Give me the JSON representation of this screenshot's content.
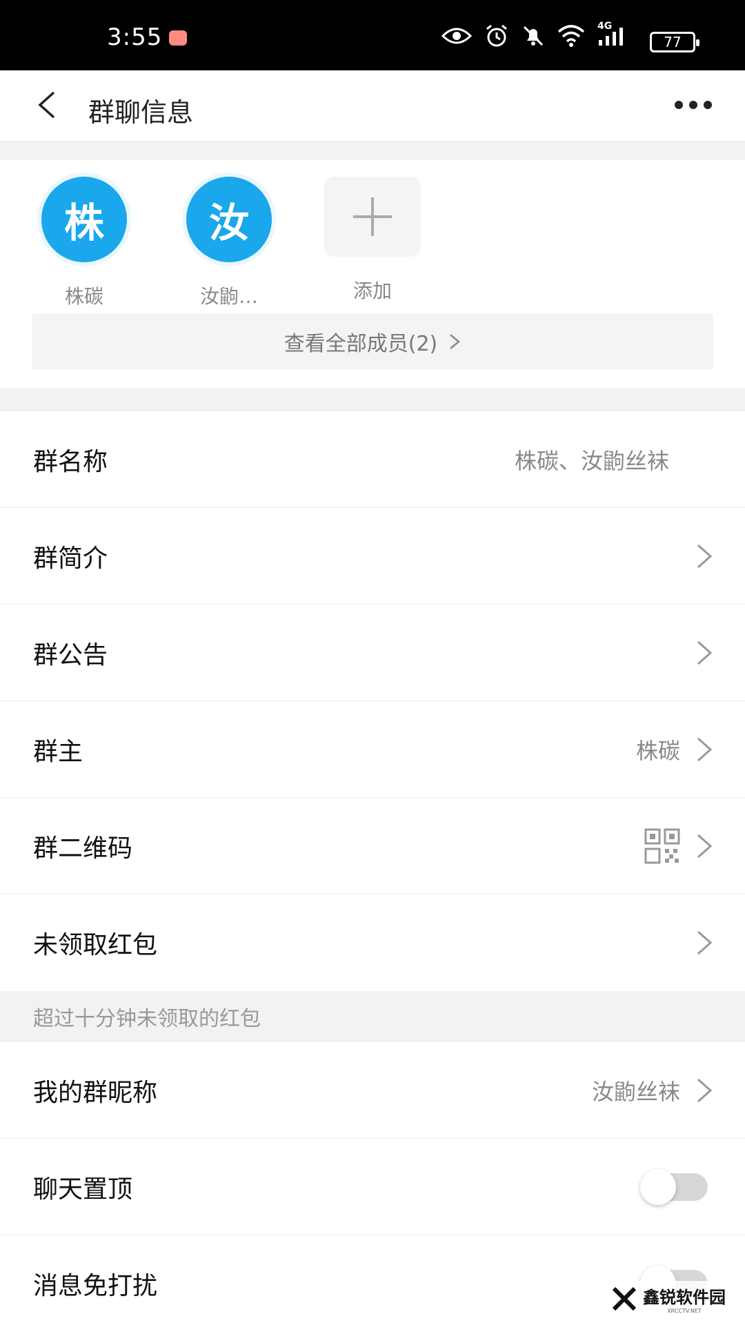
{
  "status_bar": {
    "time": "3:55",
    "network": "4G",
    "battery": "77"
  },
  "header": {
    "title": "群聊信息"
  },
  "members": {
    "items": [
      {
        "avatar_char": "株",
        "name": "株碳"
      },
      {
        "avatar_char": "汝",
        "name": "汝鼩…"
      }
    ],
    "add_label": "添加",
    "view_all_label": "查看全部成员(2)"
  },
  "settings": {
    "group_name_label": "群名称",
    "group_name_value": "株碳、汝鼩丝袜",
    "group_intro_label": "群简介",
    "group_notice_label": "群公告",
    "group_owner_label": "群主",
    "group_owner_value": "株碳",
    "group_qr_label": "群二维码",
    "red_packet_label": "未领取红包",
    "red_packet_hint": "超过十分钟未领取的红包",
    "my_nickname_label": "我的群昵称",
    "my_nickname_value": "汝鼩丝袜",
    "pin_chat_label": "聊天置顶",
    "pin_chat_on": false,
    "mute_label": "消息免打扰",
    "mute_on": false
  },
  "watermark": {
    "text": "鑫锐软件园",
    "sub": "XRCCTV.NET"
  },
  "colors": {
    "accent": "#1aa7ec",
    "status_bar": "#000000",
    "background": "#f2f2f2"
  }
}
